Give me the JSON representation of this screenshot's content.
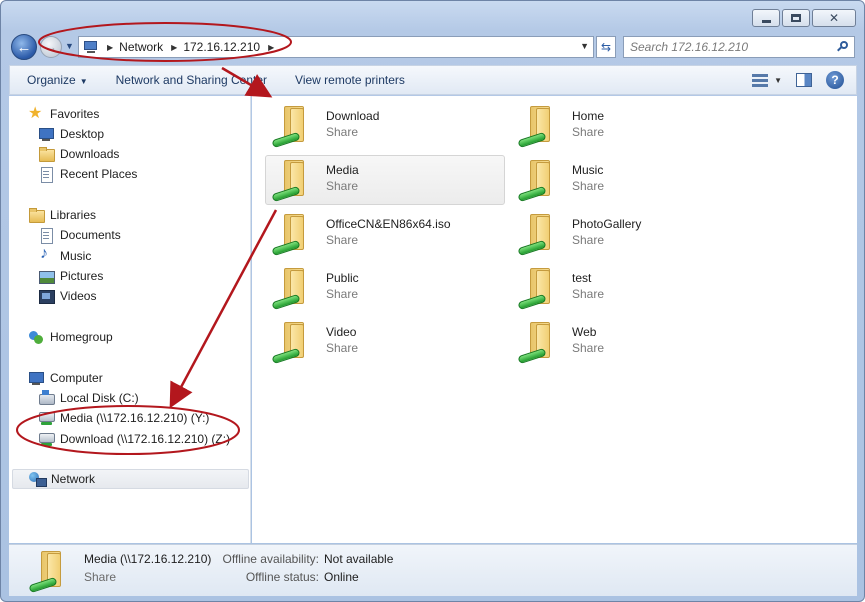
{
  "address_bar": {
    "crumbs": [
      "Network",
      "172.16.12.210"
    ]
  },
  "search": {
    "placeholder": "Search 172.16.12.210"
  },
  "toolbar": {
    "organize": "Organize",
    "network_sharing": "Network and Sharing Center",
    "remote_printers": "View remote printers"
  },
  "nav": {
    "favorites": "Favorites",
    "desktop": "Desktop",
    "downloads": "Downloads",
    "recent_places": "Recent Places",
    "libraries": "Libraries",
    "documents": "Documents",
    "music": "Music",
    "pictures": "Pictures",
    "videos": "Videos",
    "homegroup": "Homegroup",
    "computer": "Computer",
    "local_disk": "Local Disk (C:)",
    "media_drive": "Media (\\\\172.16.12.210) (Y:)",
    "download_drive": "Download (\\\\172.16.12.210) (Z:)",
    "network": "Network"
  },
  "shares": [
    {
      "name": "Download",
      "type": "Share"
    },
    {
      "name": "Home",
      "type": "Share"
    },
    {
      "name": "Media",
      "type": "Share"
    },
    {
      "name": "Music",
      "type": "Share"
    },
    {
      "name": "OfficeCN&EN86x64.iso",
      "type": "Share"
    },
    {
      "name": "PhotoGallery",
      "type": "Share"
    },
    {
      "name": "Public",
      "type": "Share"
    },
    {
      "name": "test",
      "type": "Share"
    },
    {
      "name": "Video",
      "type": "Share"
    },
    {
      "name": "Web",
      "type": "Share"
    }
  ],
  "details": {
    "name": "Media (\\\\172.16.12.210)",
    "type": "Share",
    "offline_availability_label": "Offline availability:",
    "offline_availability_value": "Not available",
    "offline_status_label": "Offline status:",
    "offline_status_value": "Online"
  },
  "colors": {
    "annotation": "#b3171d",
    "selection": "#ececec"
  }
}
